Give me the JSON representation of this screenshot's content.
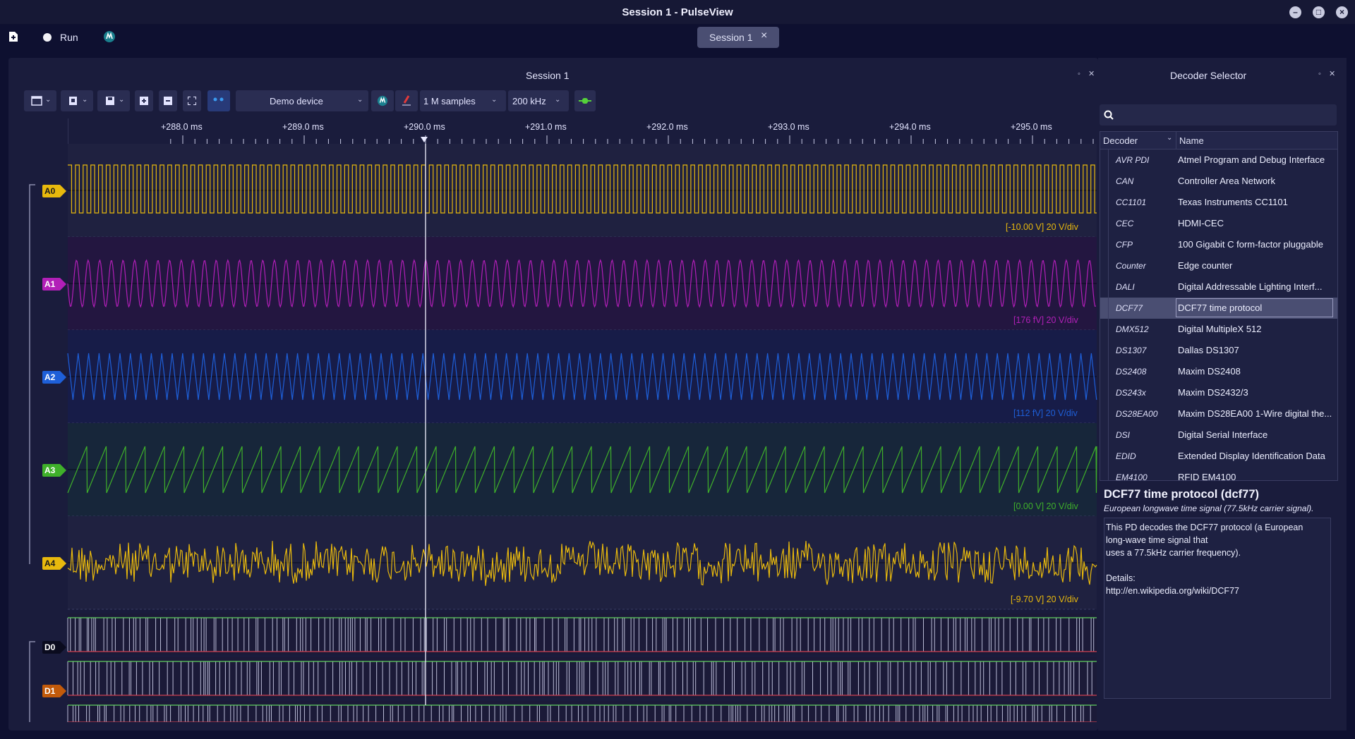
{
  "window": {
    "title": "Session 1 - PulseView",
    "buttons": [
      "–",
      "□",
      "×"
    ]
  },
  "topbar": {
    "run_label": "Run",
    "session_tab": "Session 1",
    "tab_close": "×"
  },
  "session_panel": {
    "title": "Session 1"
  },
  "toolbar": {
    "device": "Demo device",
    "samples": "1 M samples",
    "rate": "200 kHz"
  },
  "ruler": {
    "labels": [
      "+288.0 ms",
      "+289.0 ms",
      "+290.0 ms",
      "+291.0 ms",
      "+292.0 ms",
      "+293.0 ms",
      "+294.0 ms",
      "+295.0 ms"
    ]
  },
  "channels": [
    {
      "name": "A0",
      "color": "#e8b90d",
      "scale": "[-10.00 V] 20 V/div",
      "wave": "square"
    },
    {
      "name": "A1",
      "color": "#b21fb8",
      "scale": "[176 fV] 20 V/div",
      "wave": "sine"
    },
    {
      "name": "A2",
      "color": "#1e5fd8",
      "scale": "[112 fV] 20 V/div",
      "wave": "triangle"
    },
    {
      "name": "A3",
      "color": "#3fb02a",
      "scale": "[0.00 V] 20 V/div",
      "wave": "sawtooth"
    },
    {
      "name": "A4",
      "color": "#e8b90d",
      "scale": "[-9.70 V] 20 V/div",
      "wave": "noise"
    },
    {
      "name": "D0",
      "color": "#0d0f24",
      "scale": "",
      "wave": "digital"
    },
    {
      "name": "D1",
      "color": "#c25a0a",
      "scale": "",
      "wave": "digital"
    }
  ],
  "decoder_panel": {
    "title": "Decoder Selector",
    "columns": [
      "Decoder",
      "Name"
    ],
    "rows": [
      {
        "id": "AVR PDI",
        "name": "Atmel Program and Debug Interface"
      },
      {
        "id": "CAN",
        "name": "Controller Area Network"
      },
      {
        "id": "CC1101",
        "name": "Texas Instruments CC1101"
      },
      {
        "id": "CEC",
        "name": "HDMI-CEC"
      },
      {
        "id": "CFP",
        "name": "100 Gigabit C form-factor pluggable"
      },
      {
        "id": "Counter",
        "name": "Edge counter"
      },
      {
        "id": "DALI",
        "name": "Digital Addressable Lighting Interf..."
      },
      {
        "id": "DCF77",
        "name": "DCF77 time protocol"
      },
      {
        "id": "DMX512",
        "name": "Digital MultipleX 512"
      },
      {
        "id": "DS1307",
        "name": "Dallas DS1307"
      },
      {
        "id": "DS2408",
        "name": "Maxim DS2408"
      },
      {
        "id": "DS243x",
        "name": "Maxim DS2432/3"
      },
      {
        "id": "DS28EA00",
        "name": "Maxim DS28EA00 1-Wire digital the..."
      },
      {
        "id": "DSI",
        "name": "Digital Serial Interface"
      },
      {
        "id": "EDID",
        "name": "Extended Display Identification Data"
      },
      {
        "id": "EM4100",
        "name": "RFID EM4100"
      }
    ],
    "selected_index": 7,
    "detail_title": "DCF77 time protocol (dcf77)",
    "detail_subtitle": "European longwave time signal (77.5kHz carrier signal).",
    "detail_lines": [
      "This PD decodes the DCF77 protocol (a European",
      "long-wave time signal that",
      "uses a 77.5kHz carrier frequency).",
      "",
      "Details:",
      "http://en.wikipedia.org/wiki/DCF77"
    ]
  }
}
